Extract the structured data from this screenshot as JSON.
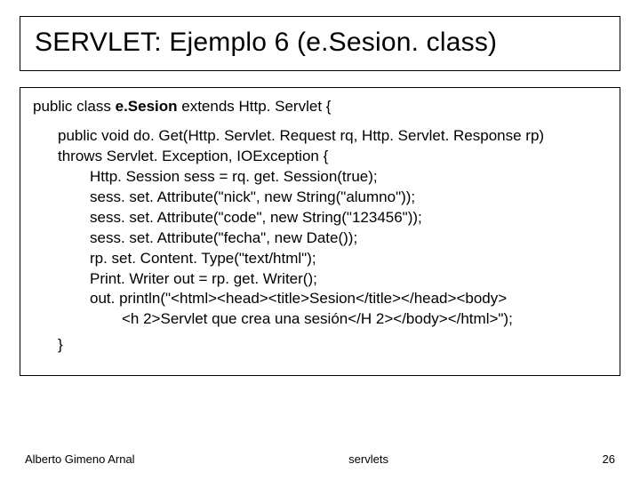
{
  "title": "SERVLET: Ejemplo 6 (e.Sesion. class)",
  "code": {
    "decl_prefix": "public class ",
    "decl_name": "e.Sesion ",
    "decl_suffix": "extends Http. Servlet {",
    "sig1": "public void do. Get(Http. Servlet. Request rq, Http. Servlet. Response rp)",
    "sig2": "throws Servlet. Exception, IOException {",
    "l1": "Http. Session sess = rq. get. Session(true);",
    "l2": "sess. set. Attribute(\"nick\", new String(\"alumno\"));",
    "l3": "sess. set. Attribute(\"code\", new String(\"123456\"));",
    "l4": "sess. set. Attribute(\"fecha\", new Date());",
    "l5": "rp. set. Content. Type(\"text/html\");",
    "l6": "Print. Writer out = rp. get. Writer();",
    "l7": "out. println(\"<html><head><title>Sesion</title></head><body>",
    "l8": "<h 2>Servlet que crea una sesión</H 2></body></html>\");",
    "close": "}"
  },
  "footer": {
    "author": "Alberto Gimeno Arnal",
    "center": "servlets",
    "page": "26"
  }
}
